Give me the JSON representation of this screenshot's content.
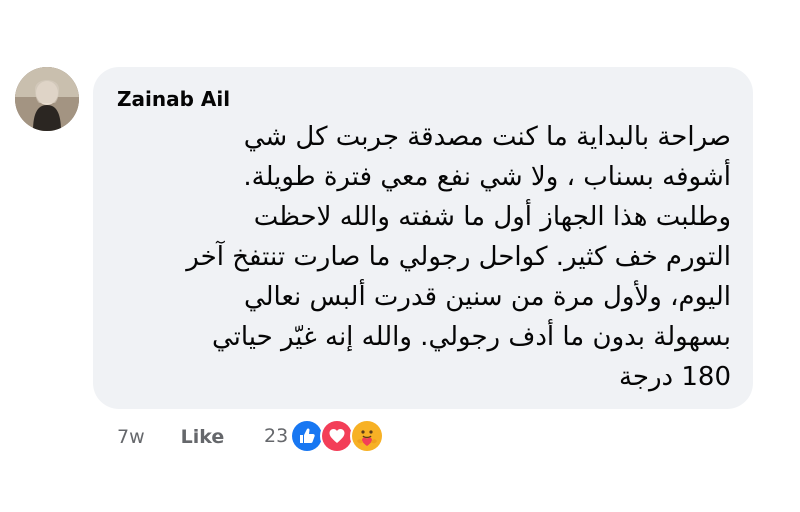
{
  "comment": {
    "author": "Zainab Ail",
    "text_lines": [
      "صراحة بالبداية ما كنت مصدقة جربت كل شي",
      "أشوفه بسناب ، ولا شي نفع معي فترة طويلة.",
      "وطلبت هذا الجهاز أول ما شفته والله لاحظت",
      "التورم خف كثير. كواحل رجولي ما صارت تنتفخ آخر",
      "اليوم، ولأول مرة من سنين قدرت ألبس نعالي",
      "بسهولة بدون ما أدف رجولي. والله إنه غيّر حياتي",
      "180 درجة"
    ]
  },
  "actions": {
    "time": "7w",
    "like_label": "Like"
  },
  "reactions": {
    "count": "23",
    "icons": [
      "like-reaction-icon",
      "love-reaction-icon",
      "care-reaction-icon"
    ]
  },
  "colors": {
    "bubble_bg": "#f0f2f5",
    "text": "#050505",
    "meta": "#65676b",
    "like_blue": "#1877f2",
    "love_red": "#f33e58",
    "care_yellow": "#f7b125"
  }
}
